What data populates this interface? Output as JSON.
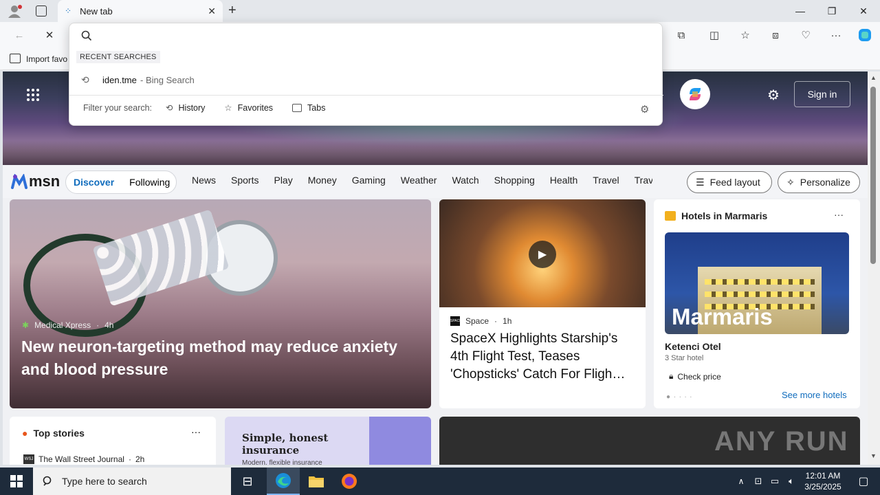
{
  "browser": {
    "tab_title": "New tab",
    "favorites_bar_item": "Import favo"
  },
  "dropdown": {
    "recent_label": "RECENT SEARCHES",
    "recent_item_query": "iden.tme",
    "recent_item_suffix": " - Bing Search",
    "filter_label": "Filter your search:",
    "filter_history": "History",
    "filter_favorites": "Favorites",
    "filter_tabs": "Tabs"
  },
  "msn": {
    "logo_text": "msn",
    "sign_in": "Sign in",
    "pill_discover": "Discover",
    "pill_following": "Following",
    "nav_items": [
      "News",
      "Sports",
      "Play",
      "Money",
      "Gaming",
      "Weather",
      "Watch",
      "Shopping",
      "Health",
      "Travel",
      "Trav"
    ],
    "feed_layout": "Feed layout",
    "personalize": "Personalize"
  },
  "cards": {
    "big": {
      "source": "Medical Xpress",
      "age": "4h",
      "headline": "New neuron-targeting method may reduce anxiety and blood pressure"
    },
    "space": {
      "source": "Space",
      "age": "1h",
      "headline": "SpaceX Highlights Starship's 4th Flight Test, Teases 'Chopsticks' Catch For Fligh…"
    },
    "hotel": {
      "section_title": "Hotels in Marmaris",
      "image_word": "Marmaris",
      "name": "Ketenci Otel",
      "stars": "3 Star hotel",
      "check_price": "Check price",
      "see_more": "See more hotels"
    },
    "top_stories": {
      "title": "Top stories",
      "source": "The Wall Street Journal",
      "age": "2h"
    },
    "ad": {
      "title": "Simple, honest insurance",
      "subtitle": "Modern, flexible insurance"
    },
    "video": {
      "watermark": "ANY RUN"
    }
  },
  "taskbar": {
    "search_placeholder": "Type here to search",
    "time": "12:01 AM",
    "date": "3/25/2025"
  },
  "colors": {
    "accent": "#0f6cbd",
    "taskbar": "#1e2b3b"
  }
}
